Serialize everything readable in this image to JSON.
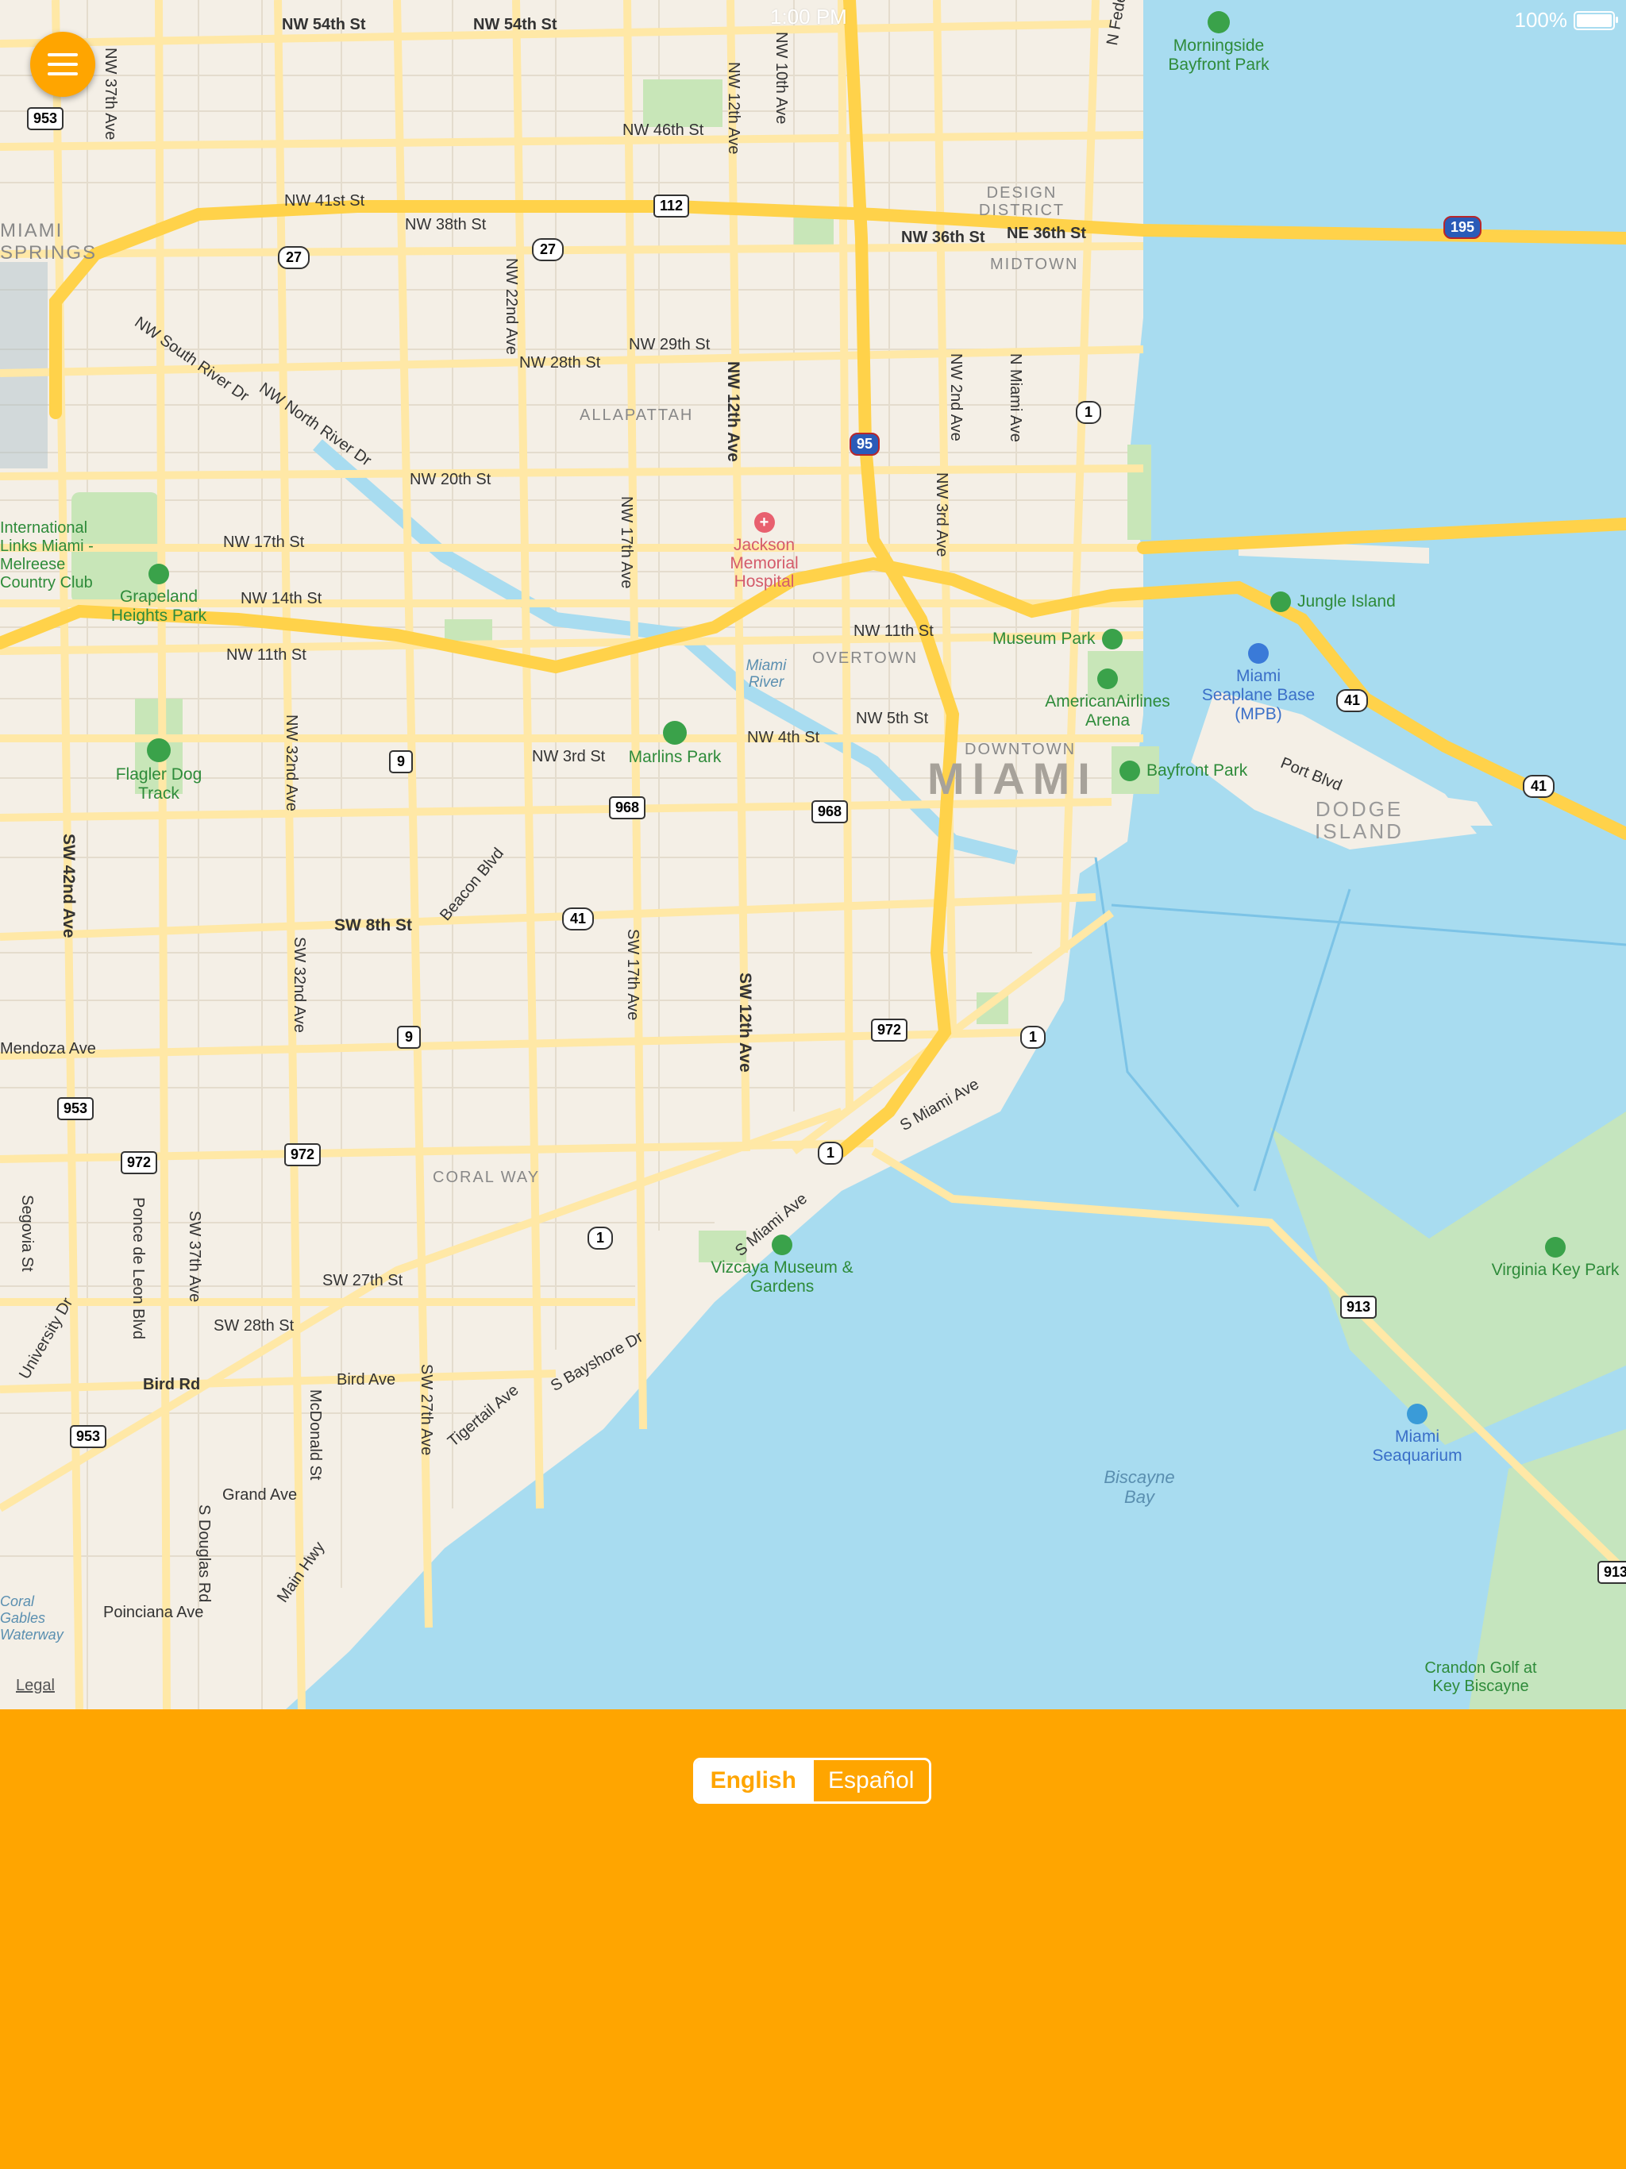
{
  "status_bar": {
    "time": "1:00 PM",
    "battery": "100%"
  },
  "map": {
    "legal_link": "Legal",
    "city_label": "MIAMI",
    "districts": [
      "DESIGN DISTRICT",
      "MIDTOWN",
      "ALLAPATTAH",
      "OVERTOWN",
      "DOWNTOWN",
      "CORAL WAY",
      "MIAMI SPRINGS",
      "DODGE ISLAND"
    ],
    "streets": [
      "NW 54th St",
      "NW 46th St",
      "NW 41st St",
      "NW 38th St",
      "NW 36th St",
      "NE 36th St",
      "NW 29th St",
      "NW 28th St",
      "NW 20th St",
      "NW 17th St",
      "NW 14th St",
      "NW 11th St",
      "NW 5th St",
      "NW 4th St",
      "NW 3rd St",
      "SW 8th St",
      "SW 27th St",
      "SW 28th St",
      "Bird Rd",
      "Bird Ave",
      "Grand Ave",
      "Poinciana Ave",
      "NW 37th Ave",
      "NW 12th Ave",
      "NW 10th Ave",
      "NW 22nd Ave",
      "NW 17th Ave",
      "NW 2nd Ave",
      "NW 3rd Ave",
      "N Miami Ave",
      "N Federal Hwy",
      "NW 32nd Ave",
      "SW 42nd Ave",
      "SW 32nd Ave",
      "SW 17th Ave",
      "SW 12th Ave",
      "SW 37th Ave",
      "SW 27th Ave",
      "Ponce de Leon Blvd",
      "Segovia St",
      "University Dr",
      "McDonald St",
      "S Douglas Rd",
      "Main Hwy",
      "Tigertail Ave",
      "S Bayshore Dr",
      "S Miami Ave",
      "Beacon Blvd",
      "Port Blvd",
      "NW South River Dr",
      "NW North River Dr",
      "Mendoza Ave"
    ],
    "pois": [
      "Morningside Bayfront Park",
      "Jungle Island",
      "Museum Park",
      "AmericanAirlines Arena",
      "Bayfront Park",
      "Miami Seaplane Base (MPB)",
      "Marlins Park",
      "Jackson Memorial Hospital",
      "Flagler Dog Track",
      "Grapeland Heights Park",
      "International Links Miami - Melreese Country Club",
      "Vizcaya Museum & Gardens",
      "Virginia Key Park",
      "Miami Seaquarium",
      "Crandon Golf at Key Biscayne"
    ],
    "water": [
      "Biscayne Bay",
      "Miami River",
      "Coral Gables Waterway"
    ],
    "shields": [
      "953",
      "27",
      "27",
      "112",
      "195",
      "1",
      "95",
      "9",
      "968",
      "968",
      "41",
      "41",
      "41",
      "9",
      "972",
      "972",
      "1",
      "1",
      "953",
      "972",
      "953",
      "1",
      "913",
      "913"
    ]
  },
  "language": {
    "english": "English",
    "spanish": "Español",
    "selected": "English"
  },
  "colors": {
    "accent": "#FFA500",
    "water": "#A8DCF0",
    "park": "#C8E6B8",
    "highway": "#FFD24A"
  }
}
